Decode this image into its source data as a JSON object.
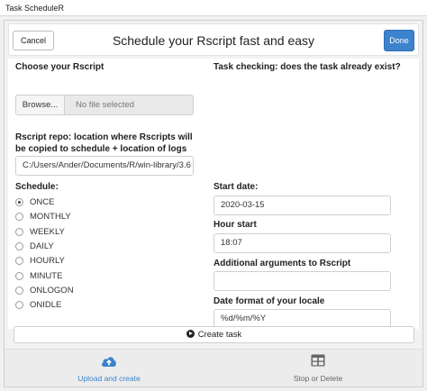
{
  "window": {
    "title": "Task ScheduleR"
  },
  "header": {
    "cancel_label": "Cancel",
    "title": "Schedule your Rscript fast and easy",
    "done_label": "Done"
  },
  "choose": {
    "label": "Choose your Rscript",
    "browse_label": "Browse...",
    "file_status": "No file selected"
  },
  "task_check": {
    "label": "Task checking: does the task already exist?"
  },
  "repo": {
    "label": "Rscript repo: location where Rscripts will be copied to schedule + location of logs",
    "value": "C:/Users/Ander/Documents/R/win-library/3.6"
  },
  "schedule": {
    "label": "Schedule:",
    "options": [
      "ONCE",
      "MONTHLY",
      "WEEKLY",
      "DAILY",
      "HOURLY",
      "MINUTE",
      "ONLOGON",
      "ONIDLE"
    ],
    "selected": "ONCE"
  },
  "start_date": {
    "label": "Start date:",
    "value": "2020-03-15"
  },
  "hour_start": {
    "label": "Hour start",
    "value": "18:07"
  },
  "args": {
    "label": "Additional arguments to Rscript",
    "value": ""
  },
  "date_format": {
    "label": "Date format of your locale",
    "value": "%d/%m/%Y"
  },
  "create_task": {
    "label": "Create task"
  },
  "tabs": [
    {
      "label": "Upload and create",
      "icon": "cloud-upload-icon",
      "active": true,
      "color": "#3c82cd"
    },
    {
      "label": "Stop or Delete",
      "icon": "table-icon",
      "active": false,
      "color": "#666666"
    }
  ],
  "colors": {
    "accent": "#3c82cd"
  }
}
